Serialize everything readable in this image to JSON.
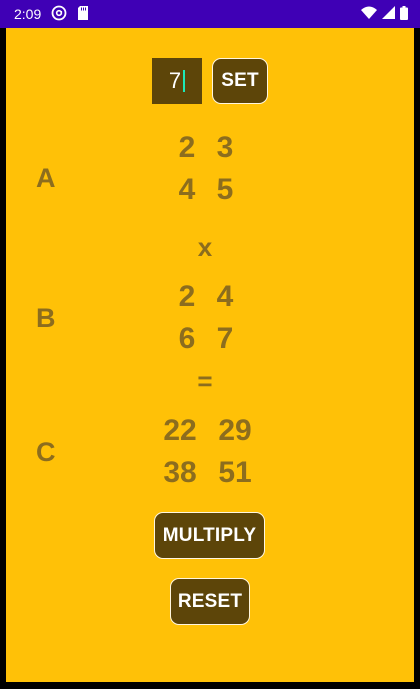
{
  "status_bar": {
    "time": "2:09",
    "icons": [
      "at-sign-icon",
      "sd-card-icon",
      "wifi-icon",
      "signal-icon",
      "battery-icon"
    ]
  },
  "input": {
    "value": "7"
  },
  "buttons": {
    "set": "SET",
    "multiply": "MULTIPLY",
    "reset": "RESET"
  },
  "matrices": {
    "a": {
      "label": "A",
      "rows": [
        [
          "2",
          "3"
        ],
        [
          "4",
          "5"
        ]
      ]
    },
    "operator": "x",
    "b": {
      "label": "B",
      "rows": [
        [
          "2",
          "4"
        ],
        [
          "6",
          "7"
        ]
      ]
    },
    "equals": "=",
    "c": {
      "label": "C",
      "rows": [
        [
          "22",
          "29"
        ],
        [
          "38",
          "51"
        ]
      ]
    }
  },
  "colors": {
    "status_bar": "#3f00b5",
    "background": "#ffc107",
    "button": "#5d4509",
    "text_muted": "#8c6d1e",
    "caret": "#1de9b6"
  }
}
